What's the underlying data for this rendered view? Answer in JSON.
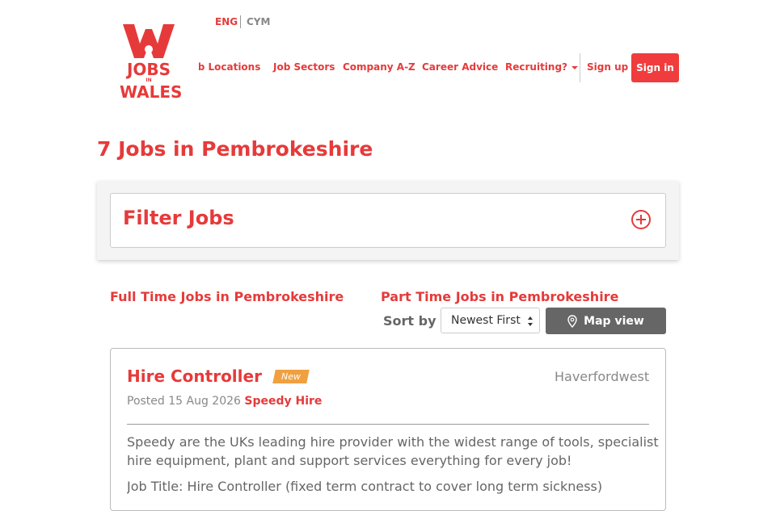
{
  "brand": {
    "logo_line1": "JOBS",
    "logo_line2": "IN",
    "logo_line3": "WALES",
    "accent_color": "#e63a3a"
  },
  "language": {
    "current": "ENG",
    "alternate": "CYM"
  },
  "nav": {
    "items": [
      "Job Locations",
      "Job Sectors",
      "Company A-Z",
      "Career Advice"
    ],
    "recruiting_label": "Recruiting?",
    "signup_label": "Sign up",
    "signin_label": "Sign in"
  },
  "page": {
    "title": "7 Jobs in Pembrokeshire"
  },
  "filter": {
    "title": "Filter Jobs",
    "toggle_icon": "plus-circle-icon"
  },
  "quick_links": {
    "full_time": "Full Time Jobs in Pembrokeshire",
    "part_time": "Part Time Jobs in Pembrokeshire"
  },
  "sort": {
    "label": "Sort by",
    "selected": "Newest First"
  },
  "map_view": {
    "label": "Map view",
    "icon": "map-pin-icon"
  },
  "jobs": [
    {
      "title": "Hire Controller",
      "badge": "New",
      "location": "Haverfordwest",
      "posted_prefix": "Posted 15 Aug 2026",
      "company": "Speedy Hire",
      "description": "Speedy are the UKs leading hire provider with the widest range of tools, specialist hire equipment, plant and support services everything for every job!",
      "description_more": "Job Title: Hire Controller (fixed term contract to cover long term sickness)"
    }
  ]
}
